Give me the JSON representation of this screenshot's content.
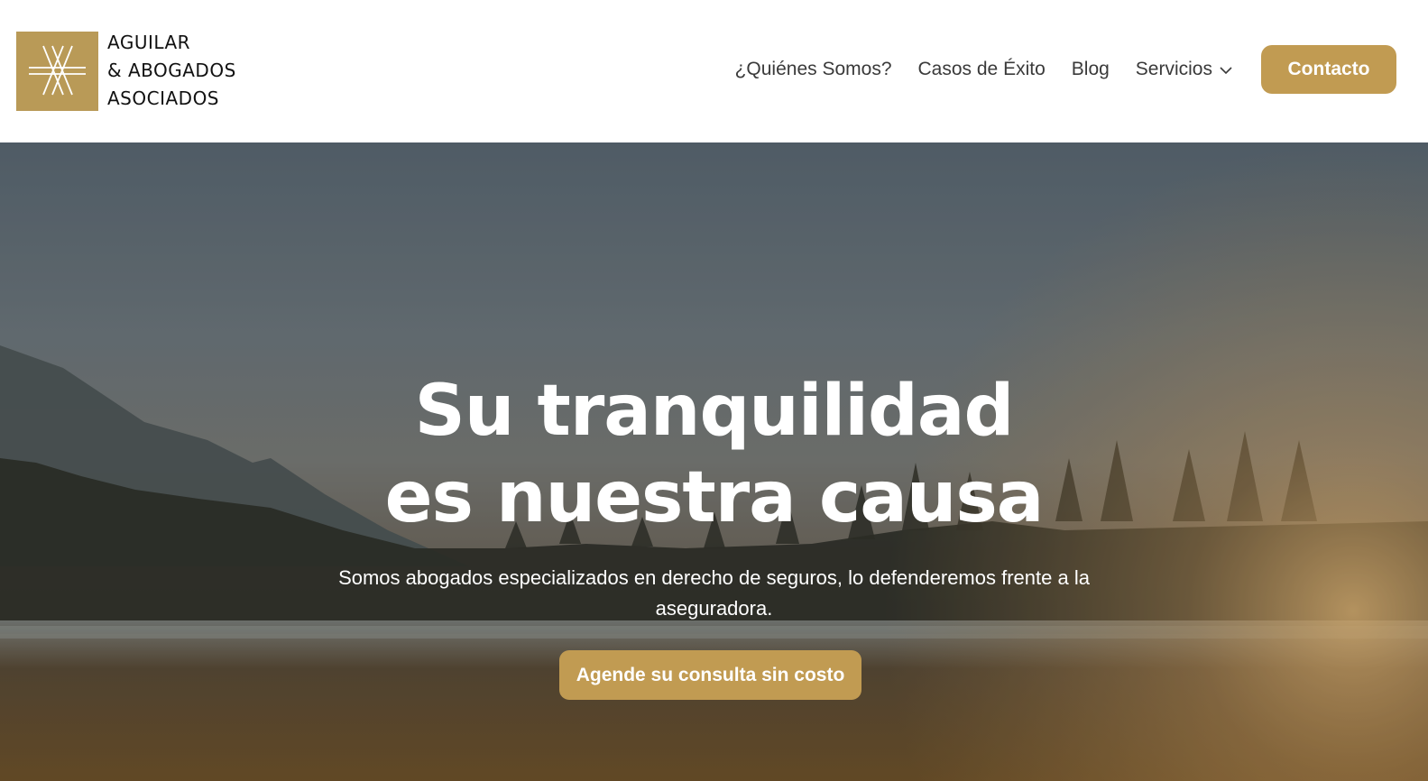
{
  "brand": {
    "lines": [
      "AGUILAR",
      "& ABOGADOS",
      "ASOCIADOS"
    ],
    "logo_icon": "monogram-logo-icon",
    "color": "#b99a57"
  },
  "nav": {
    "items": [
      {
        "label": "¿Quiénes Somos?"
      },
      {
        "label": "Casos de Éxito"
      },
      {
        "label": "Blog"
      },
      {
        "label": "Servicios",
        "icon": "chevron-down-icon"
      }
    ],
    "contact_label": "Contacto",
    "accent": "#c19b52"
  },
  "hero": {
    "title_lines": [
      "Su tranquilidad",
      "es nuestra causa"
    ],
    "subtitle": "Somos abogados especializados en derecho de seguros, lo defenderemos frente a la aseguradora.",
    "cta_label": "Agende su consulta sin costo",
    "background": "lake-forest-sunset-photo"
  }
}
